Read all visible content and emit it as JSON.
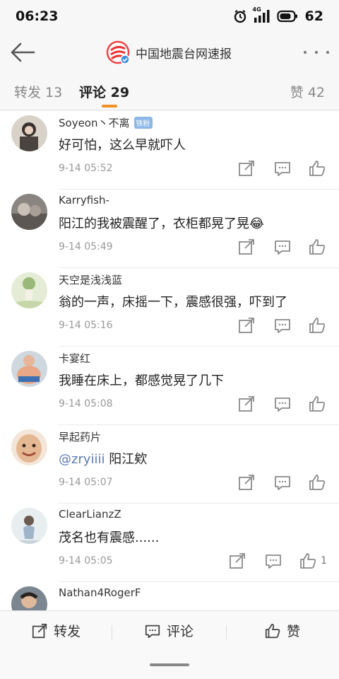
{
  "status_bar": {
    "time": "06:23",
    "network": "4G",
    "battery": "62"
  },
  "nav": {
    "title": "中国地震台网速报"
  },
  "tabs": [
    {
      "label": "转发 13"
    },
    {
      "label": "评论 29"
    },
    {
      "label": "赞 42"
    }
  ],
  "comments": [
    {
      "username": "Soyeon丶不离",
      "badge": "铁粉",
      "text": "好可怕，这么早就吓人",
      "time": "9-14 05:52"
    },
    {
      "username": "Karryfish-",
      "text": "阳江的我被震醒了，衣柜都晃了晃😂",
      "time": "9-14 05:49"
    },
    {
      "username": "天空是浅浅蓝",
      "text": "翁的一声，床摇一下，震感很强，吓到了",
      "time": "9-14 05:16"
    },
    {
      "username": "卡宴红",
      "text": "我睡在床上，都感觉晃了几下",
      "time": "9-14 05:08"
    },
    {
      "username": "早起药片",
      "mention": "@zryiiii",
      "text": " 阳江欸",
      "time": "9-14 05:07"
    },
    {
      "username": "ClearLianzZ",
      "text": "茂名也有震感......",
      "time": "9-14 05:05",
      "likes": "1"
    },
    {
      "username": "Nathan4RogerF"
    }
  ],
  "bottom_bar": {
    "repost_label": "转发",
    "comment_label": "评论",
    "like_label": "赞"
  }
}
